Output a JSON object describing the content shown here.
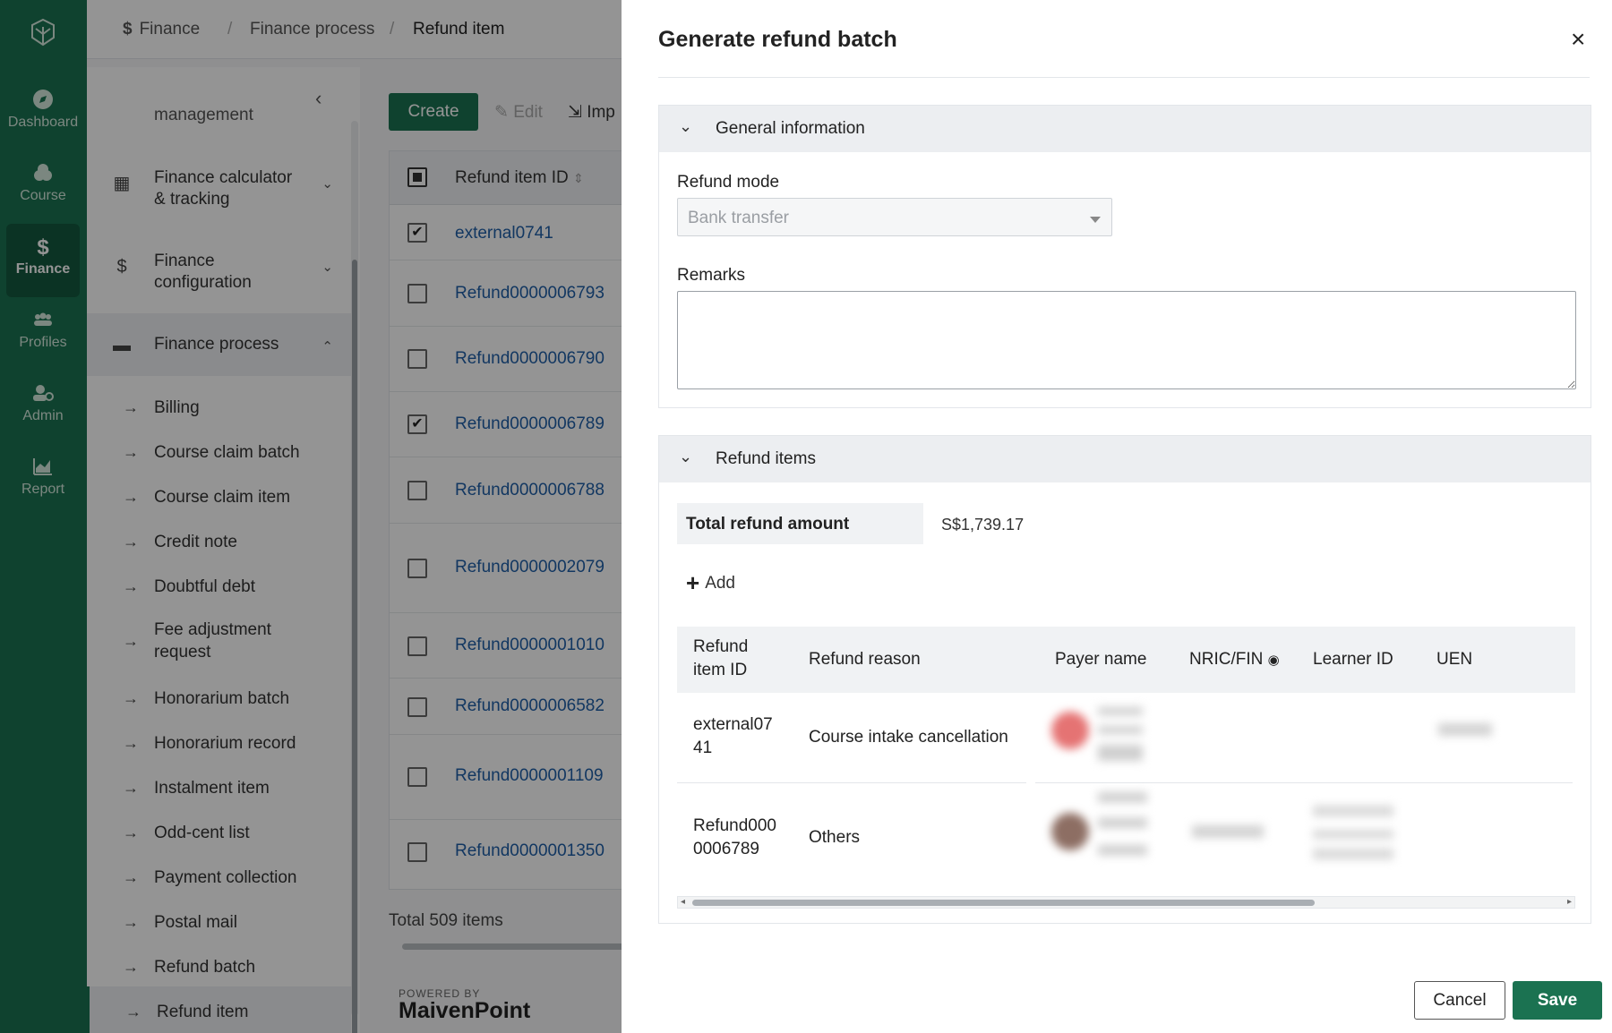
{
  "rail": {
    "items": [
      {
        "label": "Dashboard",
        "icon": "compass-icon"
      },
      {
        "label": "Course",
        "icon": "course-icon"
      },
      {
        "label": "Finance",
        "icon": "dollar-icon",
        "active": true
      },
      {
        "label": "Profiles",
        "icon": "people-icon"
      },
      {
        "label": "Admin",
        "icon": "admin-icon"
      },
      {
        "label": "Report",
        "icon": "chart-icon"
      }
    ]
  },
  "breadcrumb": {
    "root": "Finance",
    "level2": "Finance process",
    "current": "Refund item"
  },
  "sidenav": {
    "cut_item": "management",
    "groups": [
      {
        "label_l1": "Finance calculator",
        "label_l2": "& tracking"
      },
      {
        "label_l1": "Finance",
        "label_l2": "configuration"
      },
      {
        "label_l1": "Finance process",
        "label_l2": ""
      }
    ],
    "sub_items": [
      "Billing",
      "Course claim batch",
      "Course claim item",
      "Credit note",
      "Doubtful debt",
      "Fee adjustment",
      "request",
      "Honorarium batch",
      "Honorarium record",
      "Instalment item",
      "Odd-cent list",
      "Payment collection",
      "Postal mail",
      "Refund batch",
      "Refund item"
    ]
  },
  "toolbar": {
    "create": "Create",
    "edit": "Edit",
    "import": "Imp"
  },
  "grid": {
    "header": "Refund item ID",
    "rows": [
      "external0741",
      "Refund0000006793",
      "Refund0000006790",
      "Refund0000006789",
      "Refund0000006788",
      "Refund0000002079",
      "Refund0000001010",
      "Refund0000006582",
      "Refund0000001109",
      "Refund0000001350"
    ],
    "checked": [
      "✔",
      "",
      "",
      "✔",
      "",
      "",
      "",
      "",
      "",
      ""
    ],
    "total": "Total 509 items"
  },
  "footer": {
    "powered": "POWERED BY",
    "brand": "MaivenPoint"
  },
  "drawer": {
    "title": "Generate refund batch",
    "close": "×",
    "general": {
      "title": "General information",
      "refund_mode_label": "Refund mode",
      "refund_mode_value": "Bank transfer",
      "remarks_label": "Remarks",
      "remarks_value": ""
    },
    "refund_items": {
      "title": "Refund items",
      "total_label": "Total refund amount",
      "total_value": "S$1,739.17",
      "add": "Add",
      "columns": {
        "id_l1": "Refund",
        "id_l2": "item ID",
        "reason": "Refund reason",
        "payer": "Payer name",
        "nric": "NRIC/FIN",
        "learner": "Learner ID",
        "uen": "UEN"
      },
      "rows": [
        {
          "id_l1": "external07",
          "id_l2": "41",
          "reason": "Course intake cancellation"
        },
        {
          "id_l1": "Refund000",
          "id_l2": "0006789",
          "reason": "Others"
        }
      ]
    },
    "cancel": "Cancel",
    "save": "Save"
  },
  "colors": {
    "brand": "#1b7251",
    "link": "#1f5fa8"
  }
}
